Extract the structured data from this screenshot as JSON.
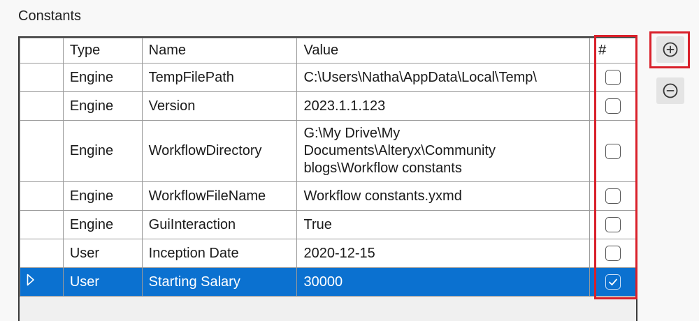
{
  "section_title": "Constants",
  "columns": {
    "indicator": "",
    "type": "Type",
    "name": "Name",
    "value": "Value",
    "flag": "#"
  },
  "rows": [
    {
      "type": "Engine",
      "name": "TempFilePath",
      "value": "C:\\Users\\Natha\\AppData\\Local\\Temp\\",
      "checked": false
    },
    {
      "type": "Engine",
      "name": "Version",
      "value": "2023.1.1.123",
      "checked": false
    },
    {
      "type": "Engine",
      "name": "WorkflowDirectory",
      "value": "G:\\My Drive\\My Documents\\Alteryx\\Community blogs\\Workflow constants",
      "checked": false
    },
    {
      "type": "Engine",
      "name": "WorkflowFileName",
      "value": "Workflow constants.yxmd",
      "checked": false
    },
    {
      "type": "Engine",
      "name": "GuiInteraction",
      "value": "True",
      "checked": false
    },
    {
      "type": "User",
      "name": "Inception Date",
      "value": "2020-12-15",
      "checked": false
    },
    {
      "type": "User",
      "name": "Starting Salary",
      "value": "30000",
      "checked": true,
      "selected": true
    }
  ],
  "buttons": {
    "add_icon": "plus-circle-icon",
    "remove_icon": "minus-circle-icon"
  },
  "colors": {
    "selection": "#0b71d0",
    "highlight_border": "#d9202a"
  }
}
